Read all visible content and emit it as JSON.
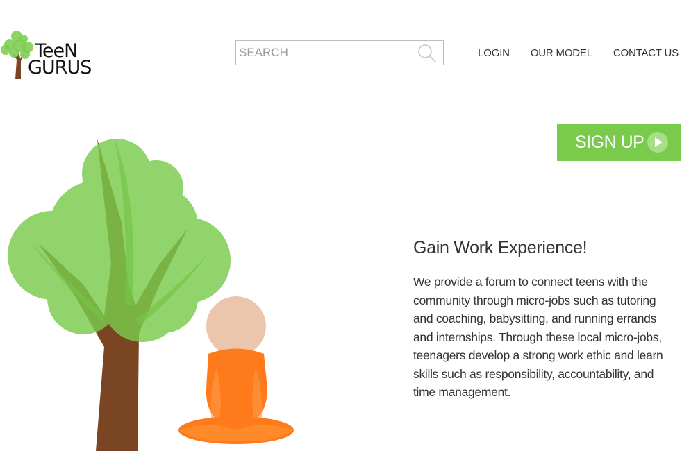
{
  "brand": {
    "logo_line_1": "TeeN",
    "logo_line_2": "GURUS"
  },
  "search": {
    "placeholder": "SEARCH",
    "icon": "search-icon"
  },
  "nav": {
    "items": [
      {
        "label": "LOGIN"
      },
      {
        "label": "OUR MODEL"
      },
      {
        "label": "CONTACT US"
      }
    ]
  },
  "signup": {
    "label": "SIGN UP",
    "icon": "play-icon",
    "color": "#7acb4b"
  },
  "hero": {
    "heading": "Gain Work Experience!",
    "body": "We provide a forum to connect teens with the community through micro-jobs such as tutoring and coaching, babysitting, and running errands and internships. Through these local micro-jobs, teenagers develop a strong work ethic and learn skills such as responsibility, accountability, and time management."
  },
  "colors": {
    "tree_leaves": "#7acb4b",
    "tree_trunk": "#7a4522",
    "monk_robe": "#ff7a1a",
    "monk_head": "#ebc6ac"
  }
}
